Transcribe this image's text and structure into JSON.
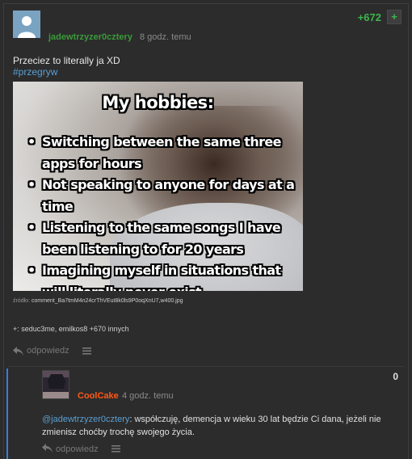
{
  "post": {
    "author": "jadewtrzyzer0cztery",
    "time": "8 godz. temu",
    "votes": "+672",
    "plus_label": "+",
    "text": "Przeciez to literally ja XD",
    "tag": "#przegryw",
    "image": {
      "title": "My hobbies:",
      "items": [
        "Switching between the same three apps for hours",
        "Not speaking to anyone for days at a time",
        "Listening to the same songs I have been listening to for 20 years",
        "Imagining myself in situations that will literally never exist"
      ]
    },
    "source_label": "źródło:",
    "source_file": "comment_Ba7tmM4n24crThVEut8k0ls9P0oqXnU7,w400.jpg",
    "voters": "+: seduc3me, emilkos8 +670 innych",
    "reply_label": "odpowiedz",
    "icons": {
      "reply": "reply-arrow-icon",
      "menu": "hamburger-menu-icon",
      "avatar": "default-user-avatar"
    }
  },
  "comment": {
    "author": "CoolCake",
    "time": "4 godz. temu",
    "votes": "0",
    "mention": "@jadewtrzyzer0cztery",
    "text": ": współczuję, demencja w wieku 30 lat będzie Ci dana, jeżeli nie zmienisz choćby trochę swojego życia.",
    "reply_label": "odpowiedz"
  },
  "colors": {
    "background": "#2c2c2c",
    "author_green": "#3a9a3a",
    "vote_green": "#3db54a",
    "tag_blue": "#5a9fd4",
    "comment_author_orange": "#ff5917",
    "reply_rail_blue": "#3b7dd8"
  }
}
